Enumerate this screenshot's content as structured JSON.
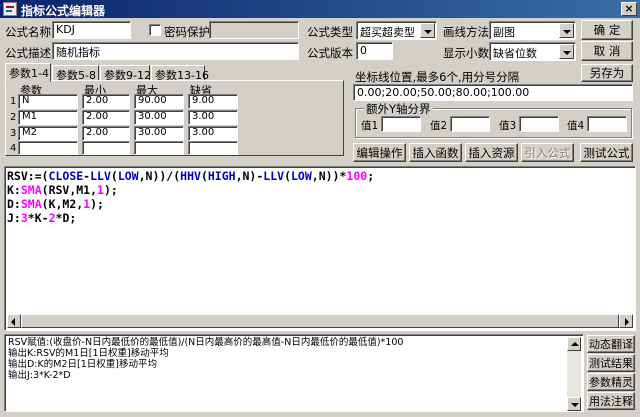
{
  "window": {
    "title": "指标公式编辑器",
    "close": "×"
  },
  "formula": {
    "name_label": "公式名称",
    "name_value": "KDJ",
    "password_label": "密码保护",
    "password_checked": false,
    "desc_label": "公式描述",
    "desc_value": "随机指标",
    "type_label": "公式类型",
    "type_value": "超买超卖型",
    "version_label": "公式版本",
    "version_value": "0",
    "draw_label": "画线方法",
    "draw_value": "副图",
    "decimal_label": "显示小数",
    "decimal_value": "缺省位数"
  },
  "buttons": {
    "ok": "确  定",
    "cancel": "取  消",
    "save_as": "另存为",
    "edit": "编辑操作",
    "insert_func": "插入函数",
    "insert_res": "插入资源",
    "import": "引入公式",
    "test": "测试公式",
    "dynamic": "动态翻译",
    "test_result": "测试结果",
    "param_wizard": "参数精灵",
    "usage": "用法注释"
  },
  "tabs": [
    "参数1-4",
    "参数5-8",
    "参数9-12",
    "参数13-16"
  ],
  "params": {
    "headers": [
      "参数",
      "最小",
      "最大",
      "缺省"
    ],
    "rows": [
      {
        "num": "1",
        "name": "N",
        "min": "2.00",
        "max": "90.00",
        "def": "9.00"
      },
      {
        "num": "2",
        "name": "M1",
        "min": "2.00",
        "max": "30.00",
        "def": "3.00"
      },
      {
        "num": "3",
        "name": "M2",
        "min": "2.00",
        "max": "30.00",
        "def": "3.00"
      },
      {
        "num": "4",
        "name": "",
        "min": "",
        "max": "",
        "def": ""
      }
    ]
  },
  "axis": {
    "label": "坐标线位置,最多6个,用分号分隔",
    "value": "0.00;20.00;50.00;80.00;100.00",
    "group_label": "额外Y轴分界",
    "values": [
      "值1",
      "值2",
      "值3",
      "值4"
    ]
  },
  "code": [
    [
      [
        "RSV:=(",
        ""
      ],
      [
        "CLOSE",
        "kw-blue"
      ],
      [
        "-",
        ""
      ],
      [
        "LLV",
        "kw-blue"
      ],
      [
        "(",
        ""
      ],
      [
        "LOW",
        "kw-blue"
      ],
      [
        ",N))/(",
        ""
      ],
      [
        "HHV",
        "kw-blue"
      ],
      [
        "(",
        ""
      ],
      [
        "HIGH",
        "kw-blue"
      ],
      [
        ",N)-",
        ""
      ],
      [
        "LLV",
        "kw-blue"
      ],
      [
        "(",
        ""
      ],
      [
        "LOW",
        "kw-blue"
      ],
      [
        ",N))*",
        ""
      ],
      [
        "100",
        "num"
      ],
      [
        ";",
        ""
      ]
    ],
    [
      [
        "K:",
        ""
      ],
      [
        "SMA",
        "kw-red"
      ],
      [
        "(RSV,M1,",
        ""
      ],
      [
        "1",
        "num"
      ],
      [
        ");",
        ""
      ]
    ],
    [
      [
        "D:",
        ""
      ],
      [
        "SMA",
        "kw-red"
      ],
      [
        "(K,M2,",
        ""
      ],
      [
        "1",
        "num"
      ],
      [
        ");",
        ""
      ]
    ],
    [
      [
        "J:",
        ""
      ],
      [
        "3",
        "num"
      ],
      [
        "*K-",
        ""
      ],
      [
        "2",
        "num"
      ],
      [
        "*D;",
        ""
      ]
    ]
  ],
  "output": [
    "RSV赋值:(收盘价-N日内最低价的最低值)/(N日内最高价的最高值-N日内最低价的最低值)*100",
    "输出K:RSV的M1日[1日权重]移动平均",
    "输出D:K的M2日[1日权重]移动平均",
    "输出J:3*K-2*D"
  ]
}
